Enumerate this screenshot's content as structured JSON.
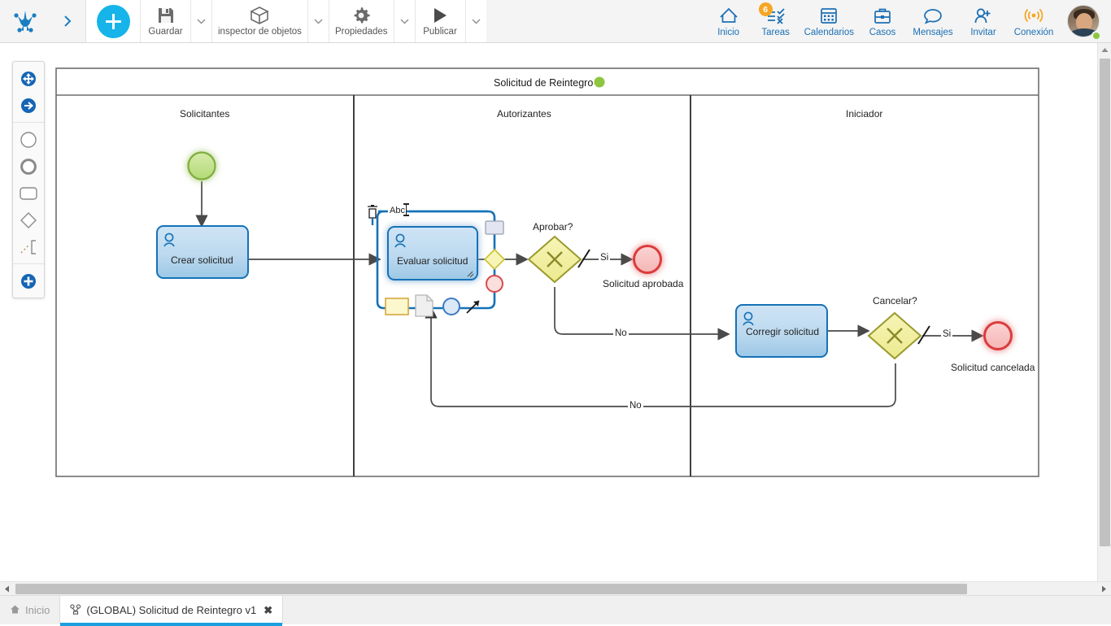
{
  "toolbar": {
    "logo_icon": "bizagi-logo-icon",
    "expand_icon": "chevron-right-icon",
    "add_icon": "plus-icon",
    "items": [
      {
        "label": "Guardar",
        "icon": "save-disk-icon",
        "caret": "⌄"
      },
      {
        "label": "inspector de objetos",
        "icon": "cube-box-icon",
        "caret": "⌄"
      },
      {
        "label": "Propiedades",
        "icon": "gear-icon",
        "caret": "⌄"
      },
      {
        "label": "Publicar",
        "icon": "play-triangle-icon",
        "caret": "⌄"
      }
    ],
    "right_items": [
      {
        "label": "Inicio",
        "icon": "home-icon",
        "badge": ""
      },
      {
        "label": "Tareas",
        "icon": "tasks-checklist-icon",
        "badge": "6"
      },
      {
        "label": "Calendarios",
        "icon": "calendar-icon",
        "badge": ""
      },
      {
        "label": "Casos",
        "icon": "briefcase-icon",
        "badge": ""
      },
      {
        "label": "Mensajes",
        "icon": "chat-bubble-icon",
        "badge": ""
      },
      {
        "label": "Invitar",
        "icon": "user-plus-icon",
        "badge": ""
      },
      {
        "label": "Conexión",
        "icon": "signal-waves-icon",
        "badge": ""
      }
    ],
    "avatar": {
      "name": "user-avatar",
      "status": "online"
    }
  },
  "palette": {
    "items": [
      {
        "name": "move-tool",
        "icon": "move-cross-arrows-icon"
      },
      {
        "name": "sequence-flow-tool",
        "icon": "arrow-right-circle-icon"
      },
      {
        "name": "start-event-tool",
        "icon": "thin-circle-icon"
      },
      {
        "name": "end-event-tool",
        "icon": "thick-circle-icon"
      },
      {
        "name": "task-tool",
        "icon": "rounded-rectangle-icon"
      },
      {
        "name": "gateway-tool",
        "icon": "diamond-icon"
      },
      {
        "name": "artifact-tool",
        "icon": "dotted-bracket-icon"
      },
      {
        "name": "add-element-tool",
        "icon": "plus-circle-icon"
      }
    ]
  },
  "diagram": {
    "pool_title": "Solicitud de Reintegro",
    "pool_status_color": "#8dc63f",
    "lanes": [
      {
        "name": "Solicitantes"
      },
      {
        "name": "Autorizantes"
      },
      {
        "name": "Iniciador"
      }
    ],
    "elements": {
      "start_event": {
        "type": "start-event",
        "label": ""
      },
      "task_crear": {
        "type": "user-task",
        "label": "Crear solicitud"
      },
      "task_evaluar": {
        "type": "user-task",
        "label": "Evaluar solicitud",
        "selected": true
      },
      "gateway_aprobar": {
        "type": "exclusive-gateway",
        "label": "Aprobar?"
      },
      "end_aprobada": {
        "type": "end-event",
        "label": "Solicitud aprobada"
      },
      "task_corregir": {
        "type": "user-task",
        "label": "Corregir solicitud"
      },
      "gateway_cancelar": {
        "type": "exclusive-gateway",
        "label": "Cancelar?"
      },
      "end_cancelada": {
        "type": "end-event",
        "label": "Solicitud cancelada"
      }
    },
    "flow_labels": {
      "aprobar_si": "Si",
      "aprobar_no": "No",
      "cancelar_si": "Si",
      "cancelar_no": "No"
    },
    "selection_toolbar": {
      "delete_icon": "trash-can-icon",
      "rename_label": "Abc",
      "text_cursor_icon": "text-cursor-icon",
      "handles": [
        {
          "name": "add-task-handle",
          "icon": "rectangle-shape-icon"
        },
        {
          "name": "add-gateway-handle",
          "icon": "yellow-diamond-icon"
        },
        {
          "name": "add-end-event-handle",
          "icon": "red-circle-icon"
        },
        {
          "name": "add-annotation-handle",
          "icon": "yellow-note-icon"
        },
        {
          "name": "add-data-object-handle",
          "icon": "document-page-icon"
        },
        {
          "name": "add-intermediate-event-handle",
          "icon": "blue-circle-icon"
        },
        {
          "name": "add-sequence-flow-handle",
          "icon": "diagonal-arrow-icon"
        }
      ]
    }
  },
  "tabs": {
    "home": {
      "label": "Inicio",
      "icon": "home-small-icon"
    },
    "active": {
      "label": "(GLOBAL) Solicitud de Reintegro v1",
      "icon": "diagram-small-icon",
      "close": "✖"
    }
  }
}
